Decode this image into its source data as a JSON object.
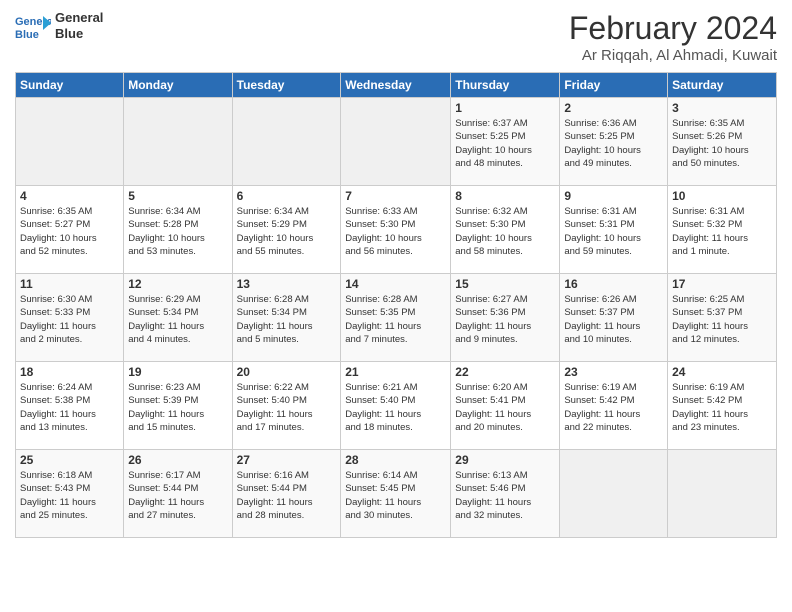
{
  "header": {
    "logo_line1": "General",
    "logo_line2": "Blue",
    "month": "February 2024",
    "location": "Ar Riqqah, Al Ahmadi, Kuwait"
  },
  "days_of_week": [
    "Sunday",
    "Monday",
    "Tuesday",
    "Wednesday",
    "Thursday",
    "Friday",
    "Saturday"
  ],
  "weeks": [
    [
      {
        "day": "",
        "info": ""
      },
      {
        "day": "",
        "info": ""
      },
      {
        "day": "",
        "info": ""
      },
      {
        "day": "",
        "info": ""
      },
      {
        "day": "1",
        "info": "Sunrise: 6:37 AM\nSunset: 5:25 PM\nDaylight: 10 hours\nand 48 minutes."
      },
      {
        "day": "2",
        "info": "Sunrise: 6:36 AM\nSunset: 5:25 PM\nDaylight: 10 hours\nand 49 minutes."
      },
      {
        "day": "3",
        "info": "Sunrise: 6:35 AM\nSunset: 5:26 PM\nDaylight: 10 hours\nand 50 minutes."
      }
    ],
    [
      {
        "day": "4",
        "info": "Sunrise: 6:35 AM\nSunset: 5:27 PM\nDaylight: 10 hours\nand 52 minutes."
      },
      {
        "day": "5",
        "info": "Sunrise: 6:34 AM\nSunset: 5:28 PM\nDaylight: 10 hours\nand 53 minutes."
      },
      {
        "day": "6",
        "info": "Sunrise: 6:34 AM\nSunset: 5:29 PM\nDaylight: 10 hours\nand 55 minutes."
      },
      {
        "day": "7",
        "info": "Sunrise: 6:33 AM\nSunset: 5:30 PM\nDaylight: 10 hours\nand 56 minutes."
      },
      {
        "day": "8",
        "info": "Sunrise: 6:32 AM\nSunset: 5:30 PM\nDaylight: 10 hours\nand 58 minutes."
      },
      {
        "day": "9",
        "info": "Sunrise: 6:31 AM\nSunset: 5:31 PM\nDaylight: 10 hours\nand 59 minutes."
      },
      {
        "day": "10",
        "info": "Sunrise: 6:31 AM\nSunset: 5:32 PM\nDaylight: 11 hours\nand 1 minute."
      }
    ],
    [
      {
        "day": "11",
        "info": "Sunrise: 6:30 AM\nSunset: 5:33 PM\nDaylight: 11 hours\nand 2 minutes."
      },
      {
        "day": "12",
        "info": "Sunrise: 6:29 AM\nSunset: 5:34 PM\nDaylight: 11 hours\nand 4 minutes."
      },
      {
        "day": "13",
        "info": "Sunrise: 6:28 AM\nSunset: 5:34 PM\nDaylight: 11 hours\nand 5 minutes."
      },
      {
        "day": "14",
        "info": "Sunrise: 6:28 AM\nSunset: 5:35 PM\nDaylight: 11 hours\nand 7 minutes."
      },
      {
        "day": "15",
        "info": "Sunrise: 6:27 AM\nSunset: 5:36 PM\nDaylight: 11 hours\nand 9 minutes."
      },
      {
        "day": "16",
        "info": "Sunrise: 6:26 AM\nSunset: 5:37 PM\nDaylight: 11 hours\nand 10 minutes."
      },
      {
        "day": "17",
        "info": "Sunrise: 6:25 AM\nSunset: 5:37 PM\nDaylight: 11 hours\nand 12 minutes."
      }
    ],
    [
      {
        "day": "18",
        "info": "Sunrise: 6:24 AM\nSunset: 5:38 PM\nDaylight: 11 hours\nand 13 minutes."
      },
      {
        "day": "19",
        "info": "Sunrise: 6:23 AM\nSunset: 5:39 PM\nDaylight: 11 hours\nand 15 minutes."
      },
      {
        "day": "20",
        "info": "Sunrise: 6:22 AM\nSunset: 5:40 PM\nDaylight: 11 hours\nand 17 minutes."
      },
      {
        "day": "21",
        "info": "Sunrise: 6:21 AM\nSunset: 5:40 PM\nDaylight: 11 hours\nand 18 minutes."
      },
      {
        "day": "22",
        "info": "Sunrise: 6:20 AM\nSunset: 5:41 PM\nDaylight: 11 hours\nand 20 minutes."
      },
      {
        "day": "23",
        "info": "Sunrise: 6:19 AM\nSunset: 5:42 PM\nDaylight: 11 hours\nand 22 minutes."
      },
      {
        "day": "24",
        "info": "Sunrise: 6:19 AM\nSunset: 5:42 PM\nDaylight: 11 hours\nand 23 minutes."
      }
    ],
    [
      {
        "day": "25",
        "info": "Sunrise: 6:18 AM\nSunset: 5:43 PM\nDaylight: 11 hours\nand 25 minutes."
      },
      {
        "day": "26",
        "info": "Sunrise: 6:17 AM\nSunset: 5:44 PM\nDaylight: 11 hours\nand 27 minutes."
      },
      {
        "day": "27",
        "info": "Sunrise: 6:16 AM\nSunset: 5:44 PM\nDaylight: 11 hours\nand 28 minutes."
      },
      {
        "day": "28",
        "info": "Sunrise: 6:14 AM\nSunset: 5:45 PM\nDaylight: 11 hours\nand 30 minutes."
      },
      {
        "day": "29",
        "info": "Sunrise: 6:13 AM\nSunset: 5:46 PM\nDaylight: 11 hours\nand 32 minutes."
      },
      {
        "day": "",
        "info": ""
      },
      {
        "day": "",
        "info": ""
      }
    ]
  ]
}
